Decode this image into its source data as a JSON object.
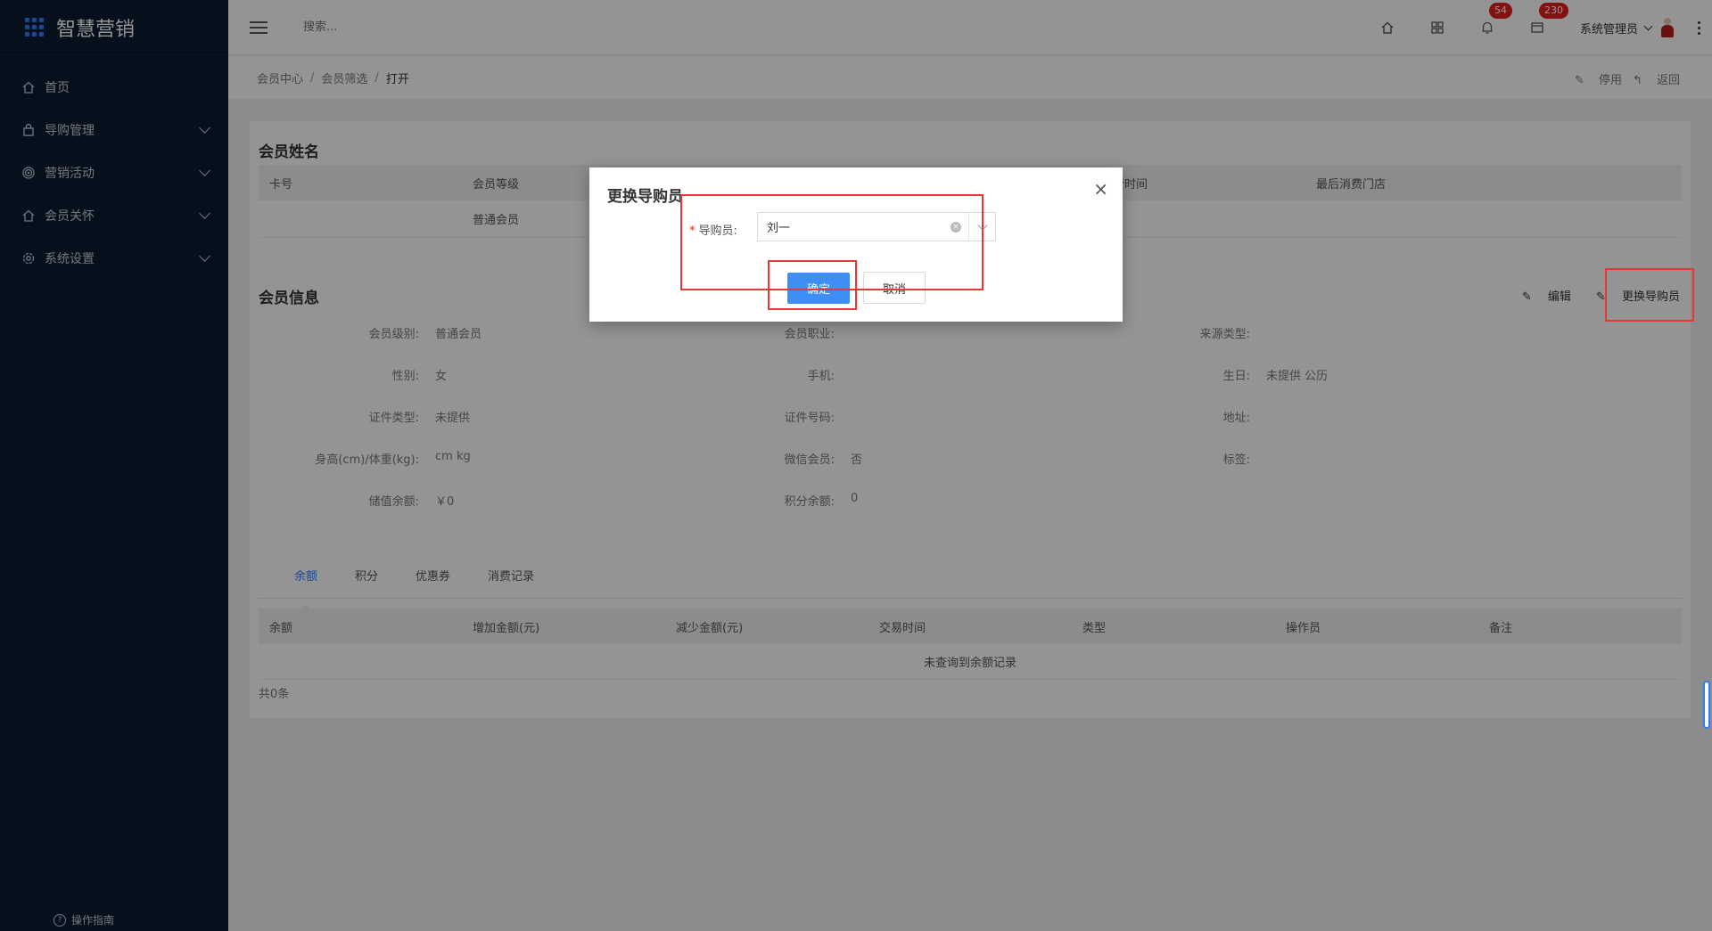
{
  "app": {
    "title": "智慧营销"
  },
  "sidebar": {
    "items": [
      {
        "label": "首页",
        "icon": "home-icon"
      },
      {
        "label": "导购管理",
        "icon": "bag-icon"
      },
      {
        "label": "营销活动",
        "icon": "target-icon"
      },
      {
        "label": "会员关怀",
        "icon": "house-icon"
      },
      {
        "label": "系统设置",
        "icon": "gear-icon"
      }
    ],
    "guide": "操作指南"
  },
  "header": {
    "search_placeholder": "搜索...",
    "notifications": "54",
    "messages": "230",
    "user": "系统管理员"
  },
  "breadcrumb": {
    "items": [
      "会员中心",
      "会员筛选"
    ],
    "current": "打开",
    "disable": "停用",
    "back": "返回"
  },
  "member_name": {
    "title": "会员姓名",
    "columns": [
      "卡号",
      "会员等级",
      "费时间",
      "最后消费门店"
    ],
    "row": [
      "",
      "普通会员",
      "",
      ""
    ]
  },
  "member_info": {
    "title": "会员信息",
    "edit": "编辑",
    "change_guide": "更换导购员",
    "rows": [
      [
        {
          "label": "会员级别:",
          "value": "普通会员"
        },
        {
          "label": "会员职业:",
          "value": ""
        },
        {
          "label": "来源类型:",
          "value": ""
        }
      ],
      [
        {
          "label": "性别:",
          "value": "女"
        },
        {
          "label": "手机:",
          "value": ""
        },
        {
          "label": "生日:",
          "value": "未提供 公历"
        }
      ],
      [
        {
          "label": "证件类型:",
          "value": "未提供"
        },
        {
          "label": "证件号码:",
          "value": ""
        },
        {
          "label": "地址:",
          "value": ""
        }
      ],
      [
        {
          "label": "身高(cm)/体重(kg):",
          "value": "cm kg"
        },
        {
          "label": "微信会员:",
          "value": "否"
        },
        {
          "label": "标签:",
          "value": ""
        }
      ],
      [
        {
          "label": "储值余额:",
          "value": "￥0"
        },
        {
          "label": "积分余额:",
          "value": "0"
        },
        {
          "label": "",
          "value": ""
        }
      ]
    ]
  },
  "tabs": [
    "余额",
    "积分",
    "优惠券",
    "消费记录"
  ],
  "balance_table": {
    "columns": [
      "余额",
      "增加金额(元)",
      "减少金额(元)",
      "交易时间",
      "类型",
      "操作员",
      "备注"
    ],
    "empty": "未查询到余额记录",
    "total": "共0条"
  },
  "dialog": {
    "title": "更换导购员",
    "field_label": "导购员:",
    "field_value": "刘一",
    "ok": "确定",
    "cancel": "取消",
    "close": "×"
  },
  "colors": {
    "accent": "#3f8ef8",
    "sidebar": "#0b1a31",
    "highlight": "#e53935",
    "badge": "#e02020"
  }
}
